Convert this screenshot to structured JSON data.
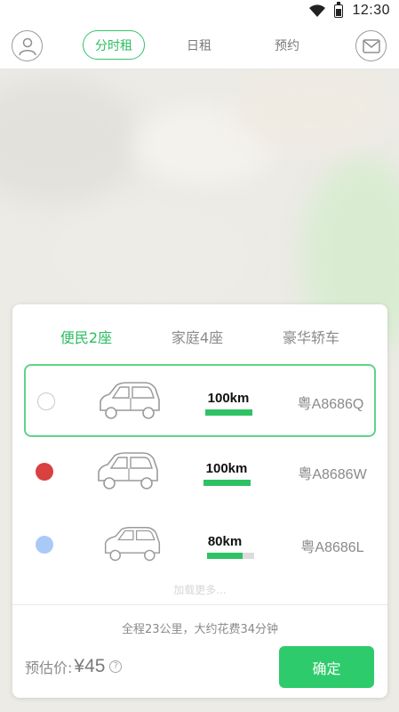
{
  "status_bar": {
    "time": "12:30"
  },
  "nav": {
    "tabs": [
      {
        "label": "分时租"
      },
      {
        "label": "日租"
      },
      {
        "label": "预约"
      }
    ]
  },
  "car_types": [
    {
      "label": "便民2座"
    },
    {
      "label": "家庭4座"
    },
    {
      "label": "豪华轿车"
    }
  ],
  "cars": [
    {
      "range": "100km",
      "plate": "粤A8686Q",
      "color": "#ffffff",
      "charge": 1.0
    },
    {
      "range": "100km",
      "plate": "粤A8686W",
      "color": "#d94040",
      "charge": 1.0
    },
    {
      "range": "80km",
      "plate": "粤A8686L",
      "color": "#a9c9f7",
      "charge": 0.75
    }
  ],
  "load_more": "加载更多...",
  "trip_summary": "全程23公里，大约花费34分钟",
  "estimate": {
    "label": "预估价:",
    "price": "¥45",
    "help": "?"
  },
  "confirm_label": "确定",
  "colors": {
    "accent": "#2ecb6c"
  }
}
